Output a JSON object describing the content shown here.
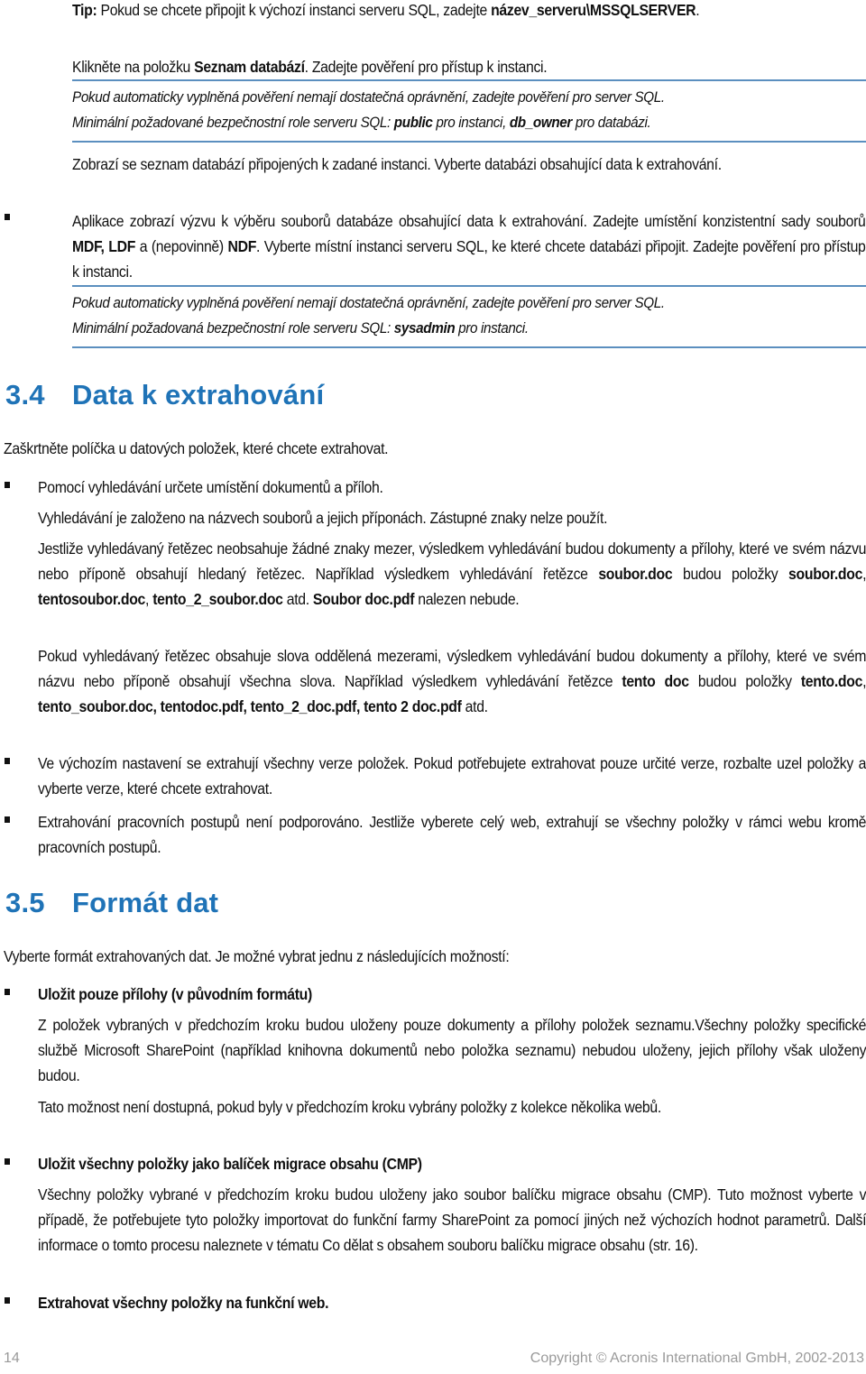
{
  "tip": {
    "label": "Tip:",
    "text": " Pokud se chcete připojit k výchozí instanci serveru SQL, zadejte ",
    "bold_value": "název_serveru\\MSSQLSERVER",
    "end": "."
  },
  "step_click": {
    "pre": "Klikněte na položku ",
    "bold": "Seznam databází",
    "post": ". Zadejte pověření pro přístup k instanci."
  },
  "note1": {
    "line1": "Pokud automaticky vyplněná pověření nemají dostatečná oprávnění, zadejte pověření pro server SQL.",
    "line2_pre": "Minimální požadované bezpečnostní role serveru SQL: ",
    "bold1": "public",
    "mid": " pro instanci, ",
    "bold2": "db_owner",
    "post": " pro databázi."
  },
  "db_list_text": "Zobrazí se seznam databází připojených k zadané instanci. Vyberte databázi obsahující data k extrahování.",
  "bullet_attach": {
    "pre": "Aplikace zobrazí výzvu k výběru souborů databáze obsahující data k extrahování. Zadejte umístění konzistentní sady souborů ",
    "bold1": "MDF, LDF",
    "mid": " a (nepovinně) ",
    "bold2": "NDF",
    "post": ". Vyberte místní instanci serveru SQL, ke které chcete databázi připojit. Zadejte pověření pro přístup k instanci."
  },
  "note2": {
    "line1": "Pokud automaticky vyplněná pověření nemají dostatečná oprávnění, zadejte pověření pro server SQL.",
    "line2_pre": "Minimální požadovaná bezpečnostní role serveru SQL: ",
    "bold": "sysadmin",
    "post": " pro instanci."
  },
  "section_34": {
    "number": "3.4",
    "title": "Data k extrahování",
    "intro": "Zaškrtněte políčka u datových položek, které chcete extrahovat.",
    "bullets": {
      "search": {
        "title": "Pomocí vyhledávání určete umístění dokumentů a příloh.",
        "p1": "Vyhledávání je založeno na názvech souborů a jejich příponách. Zástupné znaky nelze použít.",
        "p2_a": "Jestliže vyhledávaný řetězec neobsahuje žádné znaky mezer, výsledkem vyhledávání budou dokumenty a přílohy, které ve svém názvu nebo příponě obsahují hledaný řetězec. Například výsledkem vyhledávání řetězce ",
        "p2_b1": "soubor.doc",
        "p2_c": " budou položky ",
        "p2_b2": "soubor.doc",
        "p2_d": ", ",
        "p2_b3": "tentosoubor.doc",
        "p2_e": ", ",
        "p2_b4": "tento_2_soubor.doc",
        "p2_f": " atd. ",
        "p2_b5": "Soubor doc.pdf",
        "p2_g": " nalezen nebude.",
        "p3_a": "Pokud vyhledávaný řetězec obsahuje slova oddělená mezerami, výsledkem vyhledávání budou dokumenty a přílohy, které ve svém názvu nebo příponě obsahují všechna slova. Například výsledkem vyhledávání řetězce ",
        "p3_b1": "tento doc",
        "p3_c": " budou položky ",
        "p3_b2": "tento.doc",
        "p3_d": ", ",
        "p3_b3": "tento_soubor.doc, tentodoc.pdf, tento_2_doc.pdf, tento 2 doc.pdf",
        "p3_e": " atd."
      },
      "versions": "Ve výchozím nastavení se extrahují všechny verze položek. Pokud potřebujete extrahovat pouze určité verze, rozbalte uzel položky a vyberte verze, které chcete extrahovat.",
      "workflows": "Extrahování pracovních postupů není podporováno. Jestliže vyberete celý web, extrahují se všechny položky v rámci webu kromě pracovních postupů."
    }
  },
  "section_35": {
    "number": "3.5",
    "title": "Formát dat",
    "intro": "Vyberte formát extrahovaných dat. Je možné vybrat jednu z následujících možností:",
    "options": [
      {
        "title": "Uložit pouze přílohy (v původním formátu)",
        "p1": "Z položek vybraných v předchozím kroku budou uloženy pouze dokumenty a přílohy položek seznamu.Všechny položky specifické službě Microsoft SharePoint (například knihovna dokumentů nebo položka seznamu) nebudou uloženy, jejich přílohy však uloženy budou.",
        "p2": "Tato možnost není dostupná, pokud byly v předchozím kroku vybrány položky z kolekce několika webů."
      },
      {
        "title": "Uložit všechny položky jako balíček migrace obsahu (CMP)",
        "p1": "Všechny položky vybrané v předchozím kroku budou uloženy jako soubor balíčku migrace obsahu (CMP). Tuto možnost vyberte v případě, že potřebujete tyto položky importovat do funkční farmy SharePoint za pomocí jiných než výchozích hodnot parametrů. Další informace o tomto procesu naleznete v tématu Co dělat s obsahem souboru balíčku migrace obsahu (str.    16)."
      },
      {
        "title": "Extrahovat všechny položky na funkční web."
      }
    ]
  },
  "footer": {
    "page_number": "14",
    "copyright": "Copyright © Acronis International GmbH, 2002-2013"
  },
  "colors": {
    "heading": "#1f73b7",
    "rule": "#5b8fbf",
    "footer_text": "#9a9a9a"
  }
}
